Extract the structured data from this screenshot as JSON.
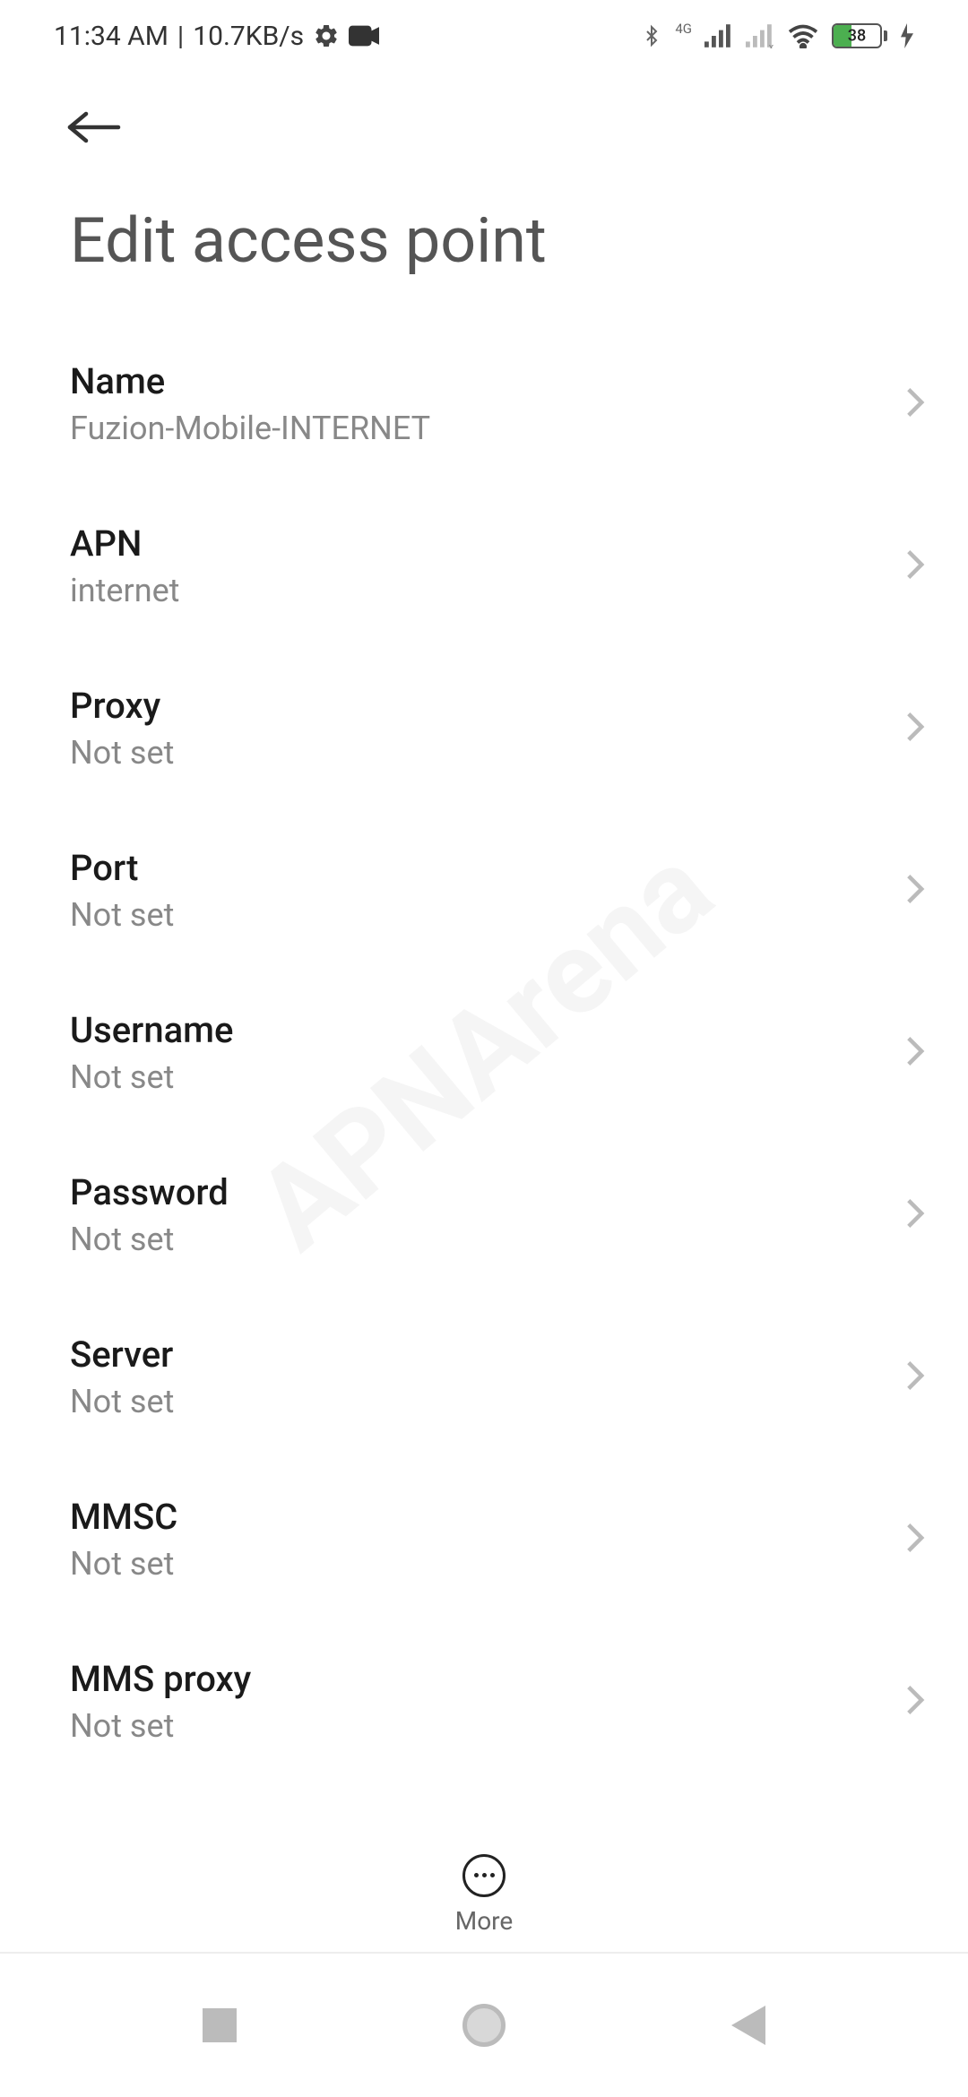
{
  "status_bar": {
    "time": "11:34 AM",
    "separator": "|",
    "data_rate": "10.7KB/s",
    "battery_percent": "38",
    "network_label": "4G"
  },
  "page": {
    "title": "Edit access point"
  },
  "settings": [
    {
      "label": "Name",
      "value": "Fuzion-Mobile-INTERNET"
    },
    {
      "label": "APN",
      "value": "internet"
    },
    {
      "label": "Proxy",
      "value": "Not set"
    },
    {
      "label": "Port",
      "value": "Not set"
    },
    {
      "label": "Username",
      "value": "Not set"
    },
    {
      "label": "Password",
      "value": "Not set"
    },
    {
      "label": "Server",
      "value": "Not set"
    },
    {
      "label": "MMSC",
      "value": "Not set"
    },
    {
      "label": "MMS proxy",
      "value": "Not set"
    }
  ],
  "bottom_action": {
    "label": "More"
  },
  "watermark": "APNArena"
}
